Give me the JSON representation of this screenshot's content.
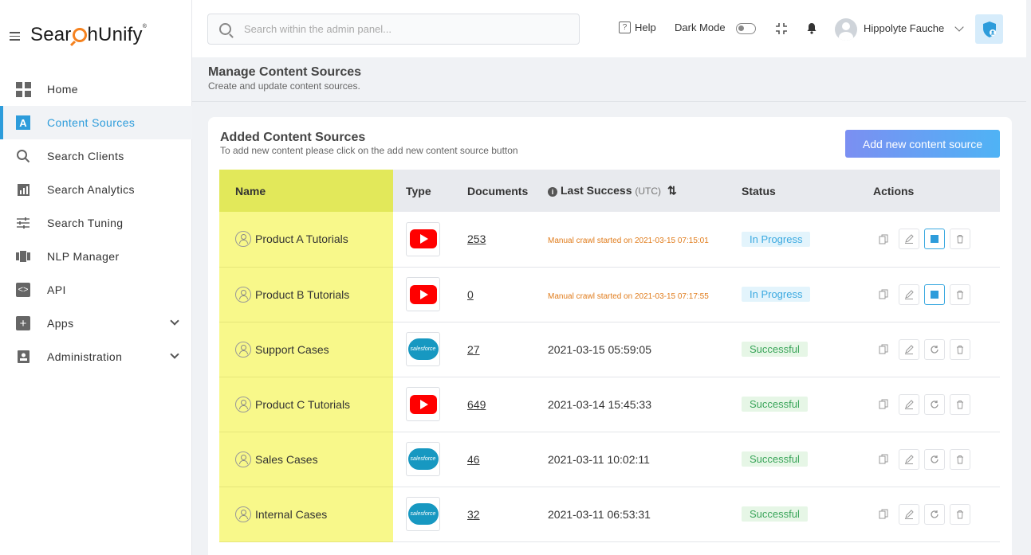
{
  "brand": {
    "logo_pre": "Sear",
    "logo_post": "hUnify",
    "logo_reg": "®"
  },
  "sidebar": {
    "items": [
      {
        "label": "Home",
        "icon": "grid-icon"
      },
      {
        "label": "Content Sources",
        "icon": "content-sources-icon",
        "active": true
      },
      {
        "label": "Search Clients",
        "icon": "search-icon"
      },
      {
        "label": "Search Analytics",
        "icon": "analytics-icon"
      },
      {
        "label": "Search Tuning",
        "icon": "tuning-icon"
      },
      {
        "label": "NLP Manager",
        "icon": "nlp-icon"
      },
      {
        "label": "API",
        "icon": "api-icon"
      },
      {
        "label": "Apps",
        "icon": "plus-box-icon",
        "expandable": true
      },
      {
        "label": "Administration",
        "icon": "admin-icon",
        "expandable": true
      }
    ]
  },
  "header": {
    "search_placeholder": "Search within the admin panel...",
    "help_label": "Help",
    "dark_mode_label": "Dark Mode",
    "user_name": "Hippolyte Fauche"
  },
  "page": {
    "title": "Manage Content Sources",
    "subtitle": "Create and update content sources."
  },
  "card": {
    "title": "Added Content Sources",
    "subtitle": "To add new content please click on the add new content source button",
    "add_button": "Add new content source"
  },
  "table": {
    "headers": {
      "name": "Name",
      "type": "Type",
      "documents": "Documents",
      "last_success": "Last Success",
      "last_success_unit": "(UTC)",
      "status": "Status",
      "actions": "Actions"
    },
    "rows": [
      {
        "name": "Product A Tutorials",
        "type": "youtube",
        "documents": "253",
        "last_success": "Manual crawl started on 2021-03-15 07:15:01",
        "crawling": true,
        "status": "In Progress"
      },
      {
        "name": "Product B Tutorials",
        "type": "youtube",
        "documents": "0",
        "last_success": "Manual crawl started on 2021-03-15 07:17:55",
        "crawling": true,
        "status": "In Progress"
      },
      {
        "name": "Support Cases",
        "type": "salesforce",
        "documents": "27",
        "last_success": "2021-03-15 05:59:05",
        "crawling": false,
        "status": "Successful"
      },
      {
        "name": "Product C Tutorials",
        "type": "youtube",
        "documents": "649",
        "last_success": "2021-03-14 15:45:33",
        "crawling": false,
        "status": "Successful"
      },
      {
        "name": "Sales Cases",
        "type": "salesforce",
        "documents": "46",
        "last_success": "2021-03-11 10:02:11",
        "crawling": false,
        "status": "Successful"
      },
      {
        "name": "Internal Cases",
        "type": "salesforce",
        "documents": "32",
        "last_success": "2021-03-11 06:53:31",
        "crawling": false,
        "status": "Successful"
      }
    ],
    "salesforce_logo_text": "salesforce"
  },
  "colors": {
    "accent": "#2d9cdb",
    "highlight": "#f8f88a",
    "crawl_text": "#e07b1a"
  }
}
